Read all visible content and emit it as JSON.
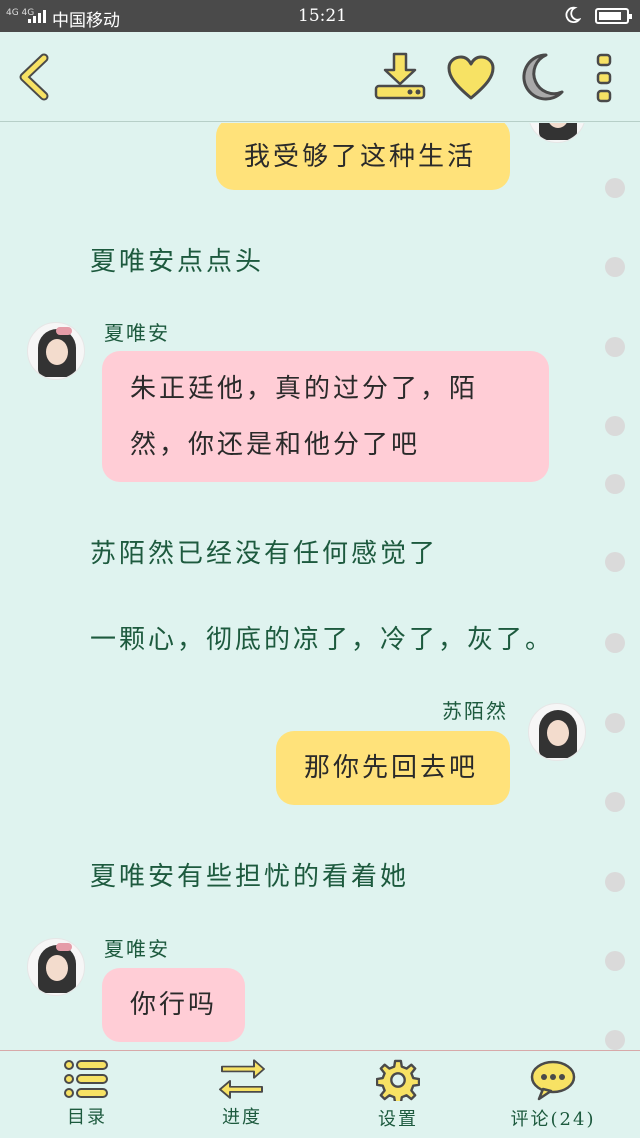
{
  "status_bar": {
    "network": "4G 4G",
    "carrier": "中国移动",
    "time": "15:21",
    "battery_level": 0.85
  },
  "colors": {
    "background": "#dff3ef",
    "accent_yellow": "#ffe27a",
    "bubble_pink": "#ffcdd6",
    "text_green": "#1d5a3e",
    "icon_yellow": "#f7e264"
  },
  "messages": [
    {
      "type": "bubble",
      "side": "right",
      "color": "yellow",
      "text": "我受够了这种生活"
    },
    {
      "type": "narration",
      "text": "夏唯安点点头"
    },
    {
      "type": "bubble",
      "side": "left",
      "color": "pink",
      "speaker": "夏唯安",
      "lines": [
        "朱正廷他，真的过分了，陌",
        "然，你还是和他分了吧"
      ]
    },
    {
      "type": "narration",
      "text": "苏陌然已经没有任何感觉了"
    },
    {
      "type": "narration",
      "text": "一颗心，彻底的凉了，冷了，灰了。"
    },
    {
      "type": "bubble",
      "side": "right",
      "color": "yellow",
      "speaker": "苏陌然",
      "text": "那你先回去吧"
    },
    {
      "type": "narration",
      "text": "夏唯安有些担忧的看着她"
    },
    {
      "type": "bubble",
      "side": "left",
      "color": "pink",
      "speaker": "夏唯安",
      "text": "你行吗"
    }
  ],
  "bottom_nav": [
    {
      "icon": "list-icon",
      "label": "目录"
    },
    {
      "icon": "swap-arrows-icon",
      "label": "进度"
    },
    {
      "icon": "gear-icon",
      "label": "设置"
    },
    {
      "icon": "chat-bubble-icon",
      "label": "评论(24)"
    }
  ]
}
